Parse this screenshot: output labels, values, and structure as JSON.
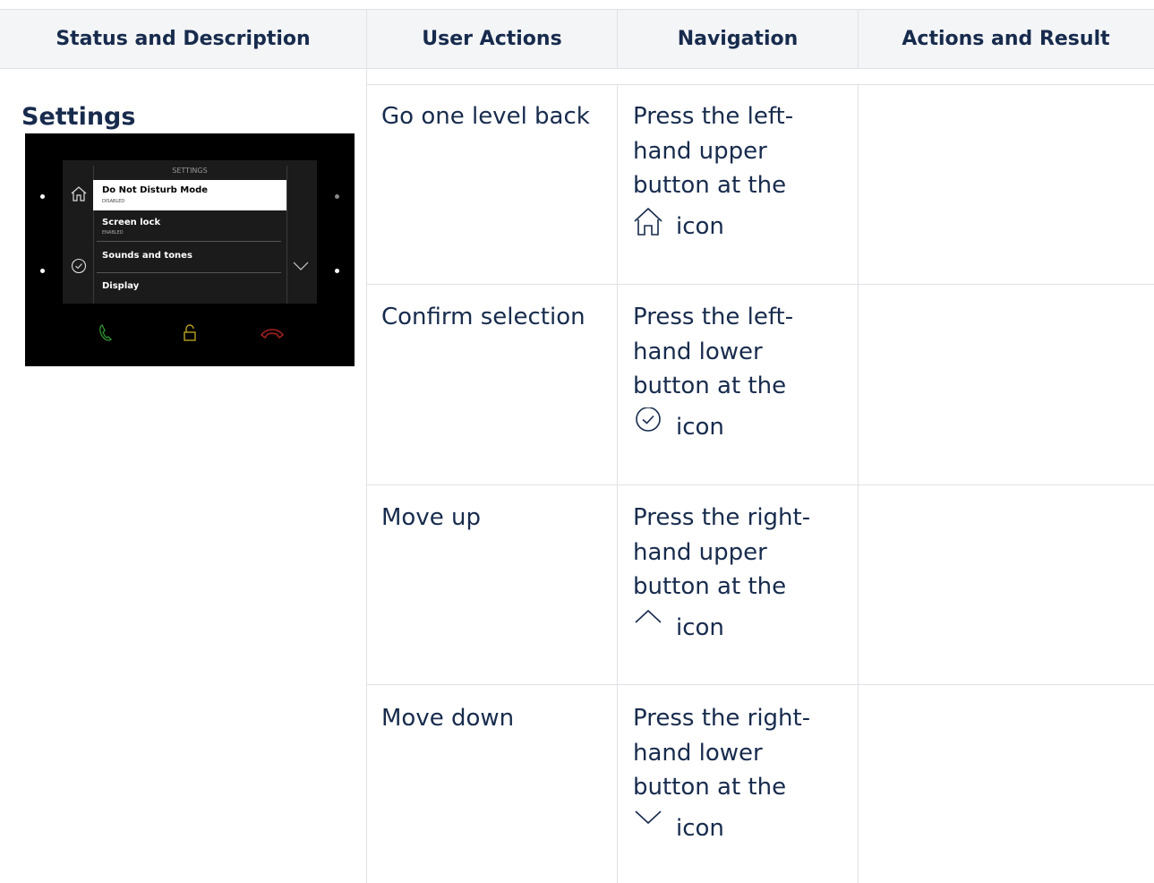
{
  "table": {
    "headers": [
      "Status and Description",
      "User Actions",
      "Navigation",
      "Actions and Result"
    ],
    "section_title": "Settings",
    "rows": [
      {
        "action": "Go one level back",
        "navigation": "Press the left-hand upper button at the",
        "icon": "home-icon",
        "suffix": "icon"
      },
      {
        "action": "Confirm selection",
        "navigation": "Press the left-hand lower button at the",
        "icon": "check-circle-icon",
        "suffix": "icon"
      },
      {
        "action": "Move up",
        "navigation": "Press the right-hand upper button at the",
        "icon": "chevron-up-icon",
        "suffix": "icon"
      },
      {
        "action": "Move down",
        "navigation": "Press the right-hand lower button at the",
        "icon": "chevron-down-icon",
        "suffix": "icon"
      }
    ]
  },
  "device": {
    "screen_title": "SETTINGS",
    "menu": [
      {
        "label": "Do Not Disturb Mode",
        "sub": "DISABLED",
        "selected": true
      },
      {
        "label": "Screen lock",
        "sub": "ENABLED",
        "selected": false
      },
      {
        "label": "Sounds and tones",
        "sub": "",
        "selected": false
      },
      {
        "label": "Display",
        "sub": "",
        "selected": false
      }
    ],
    "bottom_icons": [
      "phone-accept-icon",
      "lock-icon",
      "phone-reject-icon"
    ],
    "colors": {
      "accept": "#2e8b2e",
      "lock": "#b8a020",
      "reject": "#a02020"
    }
  },
  "colors": {
    "header_bg": "#f4f5f7",
    "border": "#dfe1e6",
    "text": "#172b4d"
  }
}
